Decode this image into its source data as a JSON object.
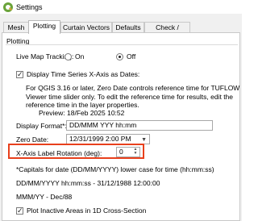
{
  "window": {
    "title": "Settings"
  },
  "tabs": [
    "Mesh",
    "Plotting",
    "Curtain Vectors",
    "Defaults",
    "Check / Debug"
  ],
  "active_tab": "Plotting",
  "group": {
    "title": "Plotting"
  },
  "live_map": {
    "label": "Live Map Tracking:",
    "on_label": "On",
    "off_label": "Off",
    "selected": "Off"
  },
  "display_ts": {
    "label": "Display Time Series X-Axis as Dates:",
    "checked": true,
    "note": "For QGIS 3.16 or later, Zero Date controls reference time for TUFLOW Viewer time slider only. To edit the reference time for results, edit the reference time in the layer properties."
  },
  "preview": {
    "label": "Preview:",
    "value": "18/Feb 2025 10:52"
  },
  "display_format": {
    "label": "Display Format*:",
    "value": "DD/MMM YYY hh:mm"
  },
  "zero_date": {
    "label": "Zero Date:",
    "value": "12/31/1999 2:00 PM"
  },
  "xaxis_rotation": {
    "label": "X-Axis Label Rotation (deg):",
    "value": "0"
  },
  "capitals_note": "*Capitals for date (DD/MM/YYYY) lower case for time (hh:mm:ss)",
  "format_example_1": "DD/MM/YYYY hh:mm:ss - 31/12/1988 12:00:00",
  "format_example_2": "MMM/YY - Dec/88",
  "plot_inactive": {
    "label": "Plot Inactive Areas in 1D Cross-Section",
    "checked": true
  },
  "colors": {
    "highlight": "#e8401c"
  }
}
